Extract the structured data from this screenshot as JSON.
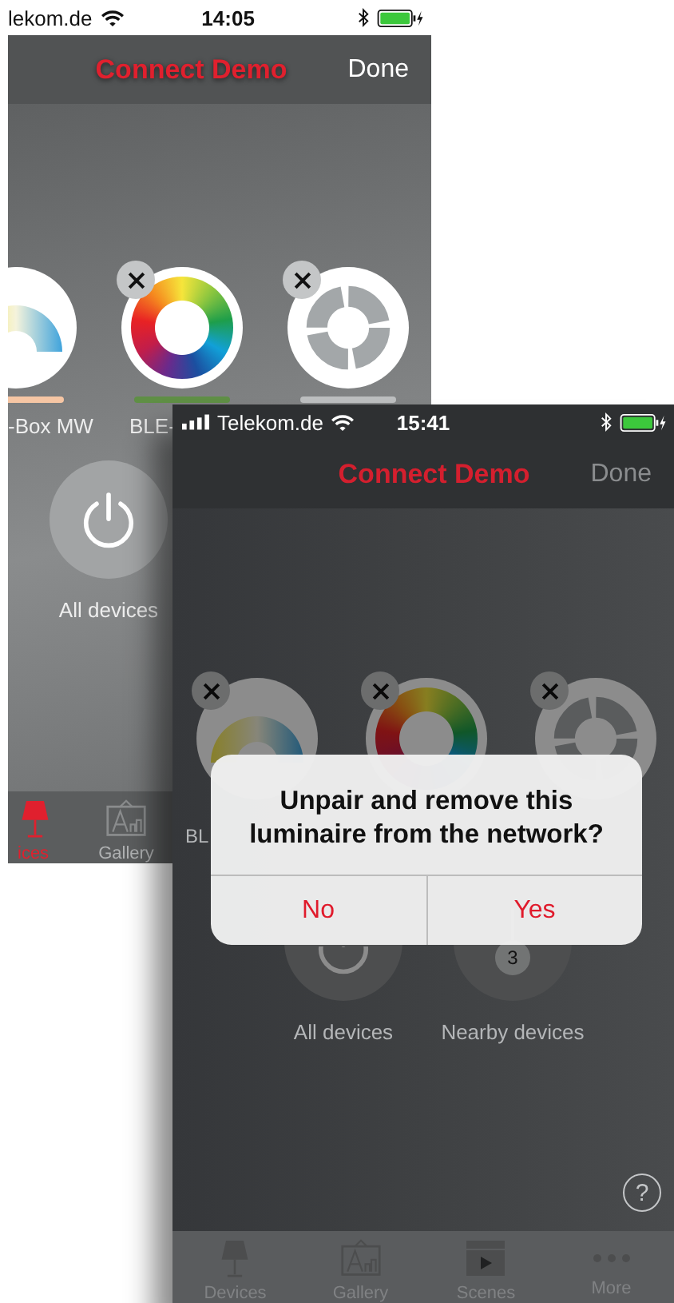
{
  "screens": [
    {
      "dimmed": false,
      "status_bar": {
        "carrier": "lekom.de",
        "time": "14:05"
      },
      "nav_bar": {
        "title": "Connect Demo",
        "done": "Done"
      },
      "luminaires": [
        {
          "kind": "tunable",
          "label": "-Box MW",
          "color": "#f6c6a4"
        },
        {
          "kind": "rgb",
          "label": "BLE-",
          "color": "#5f8f45"
        },
        {
          "kind": "dimmer",
          "color": "#bcbebf"
        }
      ],
      "groups": [
        {
          "kind": "all",
          "label": "All devices"
        }
      ],
      "tabs": [
        {
          "kind": "devices",
          "label": "ices",
          "selected": true
        },
        {
          "kind": "gallery",
          "label": "Gallery",
          "selected": false
        }
      ]
    },
    {
      "dimmed": true,
      "status_bar": {
        "carrier": "Telekom.de",
        "time": "15:41"
      },
      "nav_bar": {
        "title": "Connect Demo",
        "done": "Done"
      },
      "luminaires": [
        {
          "kind": "tunable",
          "label": "BL"
        },
        {
          "kind": "rgb"
        },
        {
          "kind": "dimmer"
        }
      ],
      "groups": [
        {
          "kind": "all",
          "label": "All devices"
        },
        {
          "kind": "nearby",
          "label": "Nearby devices",
          "badge": "3"
        }
      ],
      "help_button": "?",
      "tabs": [
        {
          "kind": "devices",
          "label": "Devices",
          "selected": false
        },
        {
          "kind": "gallery",
          "label": "Gallery",
          "selected": false
        },
        {
          "kind": "scenes",
          "label": "Scenes",
          "selected": false
        },
        {
          "kind": "more",
          "label": "More",
          "selected": false
        }
      ],
      "dialog": {
        "message": "Unpair and remove this luminaire from the network?",
        "buttons": [
          "No",
          "Yes"
        ]
      }
    }
  ]
}
